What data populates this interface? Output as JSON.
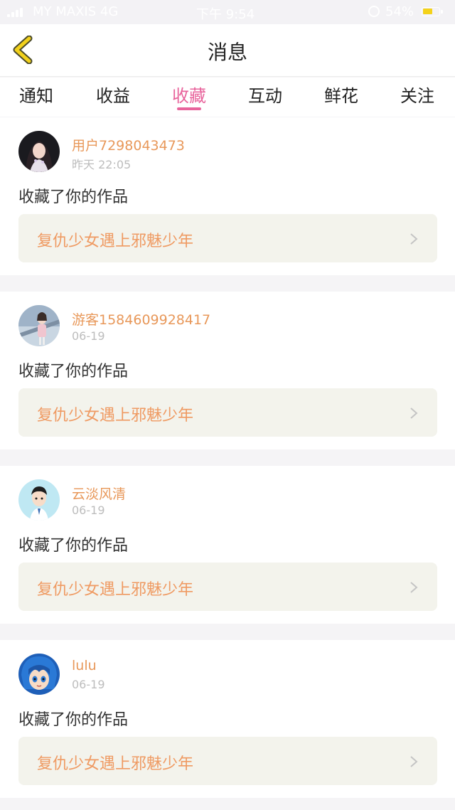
{
  "status_bar": {
    "carrier": "MY MAXIS 4G",
    "time": "下午 9:54",
    "battery_percent": "54%",
    "battery_color": "#f4d21a"
  },
  "nav": {
    "title": "消息",
    "back_icon": "chevron-left-icon",
    "back_color": "#f2d11c"
  },
  "tabs": [
    {
      "label": "通知"
    },
    {
      "label": "收益"
    },
    {
      "label": "收藏"
    },
    {
      "label": "互动"
    },
    {
      "label": "鲜花"
    },
    {
      "label": "关注"
    }
  ],
  "active_tab": "收藏",
  "accent_color": "#e8649c",
  "notifications": [
    {
      "user": "用户7298043473",
      "time": "昨天 22:05",
      "action": "收藏了你的作品",
      "work": "复仇少女遇上邪魅少年"
    },
    {
      "user": "游客1584609928417",
      "time": "06-19",
      "action": "收藏了你的作品",
      "work": "复仇少女遇上邪魅少年"
    },
    {
      "user": "云淡风清",
      "time": "06-19",
      "action": "收藏了你的作品",
      "work": "复仇少女遇上邪魅少年"
    },
    {
      "user": "lulu",
      "time": "06-19",
      "action": "收藏了你的作品",
      "work": "复仇少女遇上邪魅少年"
    }
  ]
}
